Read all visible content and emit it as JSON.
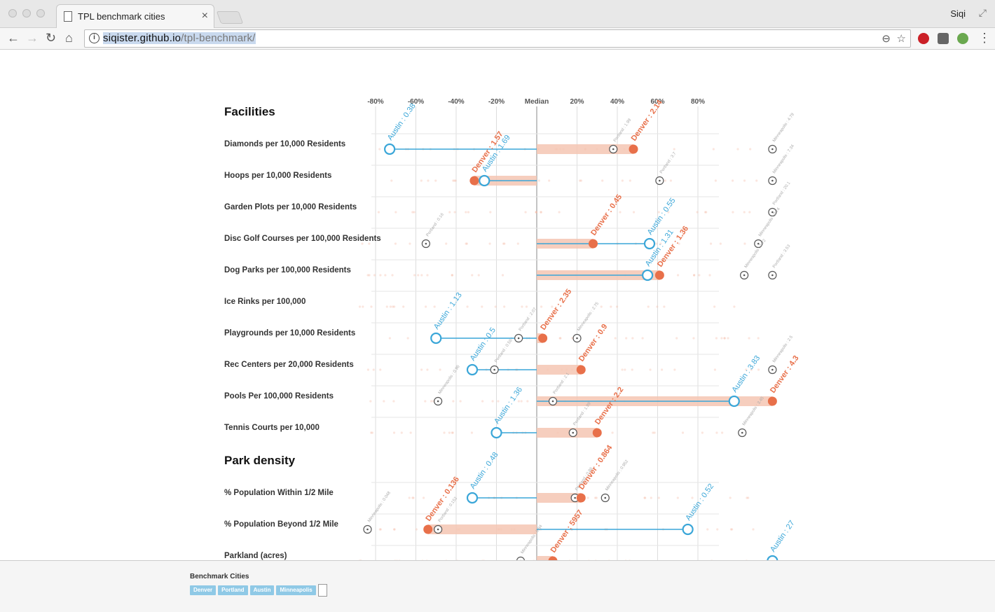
{
  "browser": {
    "tab_title": "TPL benchmark cities",
    "user": "Siqi",
    "url_host": "siqister.github.io",
    "url_path": "/tpl-benchmark/"
  },
  "axis": {
    "ticks": [
      {
        "label": "-80%",
        "v": -80
      },
      {
        "label": "-60%",
        "v": -60
      },
      {
        "label": "-40%",
        "v": -40
      },
      {
        "label": "-20%",
        "v": -20
      },
      {
        "label": "Median",
        "v": 0
      },
      {
        "label": "20%",
        "v": 20
      },
      {
        "label": "40%",
        "v": 40
      },
      {
        "label": "60%",
        "v": 60
      },
      {
        "label": "80%",
        "v": 80
      }
    ]
  },
  "colors": {
    "denver": "#e8704a",
    "austin": "#3aa6d8",
    "other": "#555555",
    "band": "#f5c6b3"
  },
  "chart_data": {
    "type": "scatter",
    "sections": [
      {
        "title": "Facilities",
        "rows": [
          {
            "label": "Diamonds per 10,000 Residents",
            "denver": {
              "v": 48,
              "text": "Denver : 2.14"
            },
            "austin": {
              "v": -73,
              "text": "Austin : 0.38"
            },
            "others": [
              {
                "v": 38,
                "text": "Portland : 1.99"
              },
              {
                "v": 117,
                "text": "Minneapolis : 4.79"
              }
            ]
          },
          {
            "label": "Hoops per 10,000 Residents",
            "denver": {
              "v": -31,
              "text": "Denver : 1.57"
            },
            "austin": {
              "v": -26,
              "text": "Austin : 1.69"
            },
            "others": [
              {
                "v": 61,
                "text": "Portland : 3.7"
              },
              {
                "v": 117,
                "text": "Minneapolis : 7.34"
              }
            ]
          },
          {
            "label": "Garden Plots per 10,000 Residents",
            "denver": null,
            "austin": null,
            "others": [
              {
                "v": 117,
                "text": "Portland : 20.1"
              }
            ]
          },
          {
            "label": "Disc Golf Courses per 100,000 Residents",
            "denver": {
              "v": 28,
              "text": "Denver : 0.45"
            },
            "austin": {
              "v": 56,
              "text": "Austin : 0.55"
            },
            "others": [
              {
                "v": -55,
                "text": "Portland : 0.16"
              },
              {
                "v": 110,
                "text": "Minneapolis : 0.74"
              }
            ]
          },
          {
            "label": "Dog Parks per 100,000 Residents",
            "denver": {
              "v": 61,
              "text": "Denver : 1.36"
            },
            "austin": {
              "v": 55,
              "text": "Austin : 1.31"
            },
            "others": [
              {
                "v": 103,
                "text": "Minneapolis : 1.72"
              },
              {
                "v": 117,
                "text": "Portland : 3.53"
              }
            ]
          },
          {
            "label": "Ice Rinks per 100,000",
            "denver": null,
            "austin": null,
            "others": []
          },
          {
            "label": "Playgrounds per 10,000 Residents",
            "denver": {
              "v": 3,
              "text": "Denver : 2.35"
            },
            "austin": {
              "v": -50,
              "text": "Austin : 1.13"
            },
            "others": [
              {
                "v": -9,
                "text": "Portland : 2.07"
              },
              {
                "v": 20,
                "text": "Minneapolis : 2.75"
              }
            ]
          },
          {
            "label": "Rec Centers per 20,000 Residents",
            "denver": {
              "v": 22,
              "text": "Denver : 0.9"
            },
            "austin": {
              "v": -32,
              "text": "Austin : 0.5"
            },
            "others": [
              {
                "v": -21,
                "text": "Portland : 0.56"
              },
              {
                "v": 117,
                "text": "Minneapolis : 2.5"
              }
            ]
          },
          {
            "label": "Pools Per 100,000 Residents",
            "denver": {
              "v": 117,
              "text": "Denver : 4.3"
            },
            "austin": {
              "v": 98,
              "text": "Austin : 3.83"
            },
            "others": [
              {
                "v": -49,
                "text": "Minneapolis : 0.96"
              },
              {
                "v": 8,
                "text": "Portland : 2.1"
              }
            ]
          },
          {
            "label": "Tennis Courts per 10,000",
            "denver": {
              "v": 30,
              "text": "Denver : 2.2"
            },
            "austin": {
              "v": -20,
              "text": "Austin : 1.36"
            },
            "others": [
              {
                "v": 18,
                "text": "Portland : 1.99"
              },
              {
                "v": 102,
                "text": "Minneapolis : 3.45"
              }
            ]
          }
        ]
      },
      {
        "title": "Park density",
        "rows": [
          {
            "label": "% Population Within 1/2 Mile",
            "denver": {
              "v": 22,
              "text": "Denver : 0.864"
            },
            "austin": {
              "v": -32,
              "text": "Austin : 0.48"
            },
            "others": [
              {
                "v": 19,
                "text": "Portland : 0.86"
              },
              {
                "v": 34,
                "text": "Minneapolis : 0.952"
              }
            ]
          },
          {
            "label": "% Population Beyond 1/2 Mile",
            "denver": {
              "v": -54,
              "text": "Denver : 0.136"
            },
            "austin": {
              "v": 75,
              "text": "Austin : 0.52"
            },
            "others": [
              {
                "v": -49,
                "text": "Portland : 0.152"
              },
              {
                "v": -84,
                "text": "Minneapolis : 0.048"
              }
            ]
          },
          {
            "label": "Parkland (acres)",
            "denver": {
              "v": 8,
              "text": "Denver : 5957"
            },
            "austin": {
              "v": 117,
              "text": "Austin : 27"
            },
            "others": [
              {
                "v": -8,
                "text": "Minneapolis : 0.84"
              }
            ]
          }
        ]
      }
    ]
  },
  "footer": {
    "title": "Benchmark Cities",
    "cities": [
      "Denver",
      "Portland",
      "Austin",
      "Minneapolis"
    ]
  }
}
